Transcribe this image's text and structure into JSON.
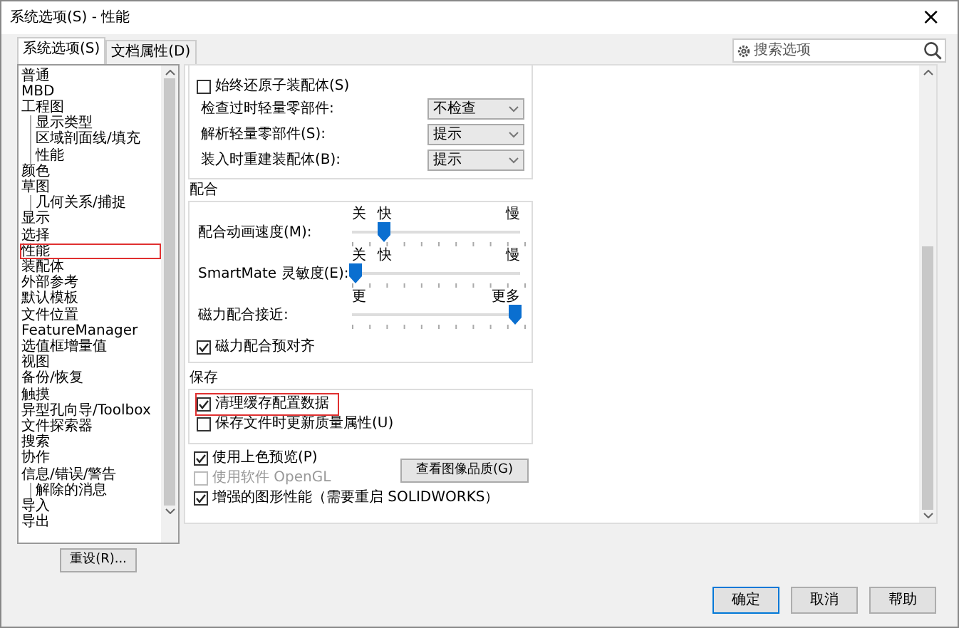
{
  "window": {
    "title": "系统选项(S) - 性能",
    "close": "×"
  },
  "tabs": [
    {
      "label": "系统选项(S)",
      "selected": true
    },
    {
      "label": "文档属性(D)",
      "selected": false
    }
  ],
  "search": {
    "placeholder": "搜索选项"
  },
  "tree": [
    {
      "label": "普通",
      "selected": false
    },
    {
      "label": "MBD",
      "selected": false
    },
    {
      "label": "工程图",
      "selected": false,
      "children": [
        {
          "label": "显示类型",
          "selected": false
        },
        {
          "label": "区域剖面线/填充",
          "selected": false
        },
        {
          "label": "性能",
          "selected": false
        }
      ]
    },
    {
      "label": "颜色",
      "selected": false
    },
    {
      "label": "草图",
      "selected": false,
      "children": [
        {
          "label": "几何关系/捕捉",
          "selected": false
        }
      ]
    },
    {
      "label": "显示",
      "selected": false
    },
    {
      "label": "选择",
      "selected": false
    },
    {
      "label": "性能",
      "selected": true
    },
    {
      "label": "装配体",
      "selected": false
    },
    {
      "label": "外部参考",
      "selected": false
    },
    {
      "label": "默认模板",
      "selected": false
    },
    {
      "label": "文件位置",
      "selected": false
    },
    {
      "label": "FeatureManager",
      "selected": false
    },
    {
      "label": "选值框增量值",
      "selected": false
    },
    {
      "label": "视图",
      "selected": false
    },
    {
      "label": "备份/恢复",
      "selected": false
    },
    {
      "label": "触摸",
      "selected": false
    },
    {
      "label": "异型孔向导/Toolbox",
      "selected": false
    },
    {
      "label": "文件探索器",
      "selected": false
    },
    {
      "label": "搜索",
      "selected": false
    },
    {
      "label": "协作",
      "selected": false
    },
    {
      "label": "信息/错误/警告",
      "selected": false,
      "children": [
        {
          "label": "解除的消息",
          "selected": false
        }
      ]
    },
    {
      "label": "导入",
      "selected": false
    },
    {
      "label": "导出",
      "selected": false
    }
  ],
  "reset_button": "重设(R)...",
  "assembly_section": {
    "checkbox": {
      "label": "始终还原子装配体(S)",
      "checked": false
    },
    "dropdowns": [
      {
        "label": "检查过时轻量零部件:",
        "value": "不检查"
      },
      {
        "label": "解析轻量零部件(S):",
        "value": "提示"
      },
      {
        "label": "装入时重建装配体(B):",
        "value": "提示"
      }
    ]
  },
  "mates_section": {
    "title": "配合",
    "sliders": [
      {
        "label": "配合动画速度(M):",
        "ticks_labels": [
          "关",
          "快",
          "慢"
        ],
        "level": 0.19
      },
      {
        "label": "SmartMate 灵敏度(E):",
        "ticks_labels": [
          "关",
          "快",
          "慢"
        ],
        "level": 0.02
      },
      {
        "label": "磁力配合接近:",
        "ticks_labels": [
          "更",
          "更多"
        ],
        "level": 0.97
      }
    ],
    "checkbox": {
      "label": "磁力配合预对齐",
      "checked": true
    }
  },
  "save_section": {
    "title": "保存",
    "checkboxes": [
      {
        "label": "清理缓存配置数据",
        "checked": true,
        "highlighted": true
      },
      {
        "label": "保存文件时更新质量属性(U)",
        "checked": false,
        "highlighted": false
      }
    ]
  },
  "display_options": [
    {
      "label": "使用上色预览(P)",
      "checked": true,
      "disabled": false
    },
    {
      "label": "使用软件 OpenGL",
      "checked": false,
      "disabled": true
    },
    {
      "label": "增强的图形性能（需要重启 SOLIDWORKS）",
      "checked": true,
      "disabled": false
    }
  ],
  "image_quality_button": "查看图像品质(G)",
  "footer_buttons": [
    {
      "label": "确定",
      "default": true
    },
    {
      "label": "取消",
      "default": false
    },
    {
      "label": "帮助",
      "default": false
    }
  ]
}
